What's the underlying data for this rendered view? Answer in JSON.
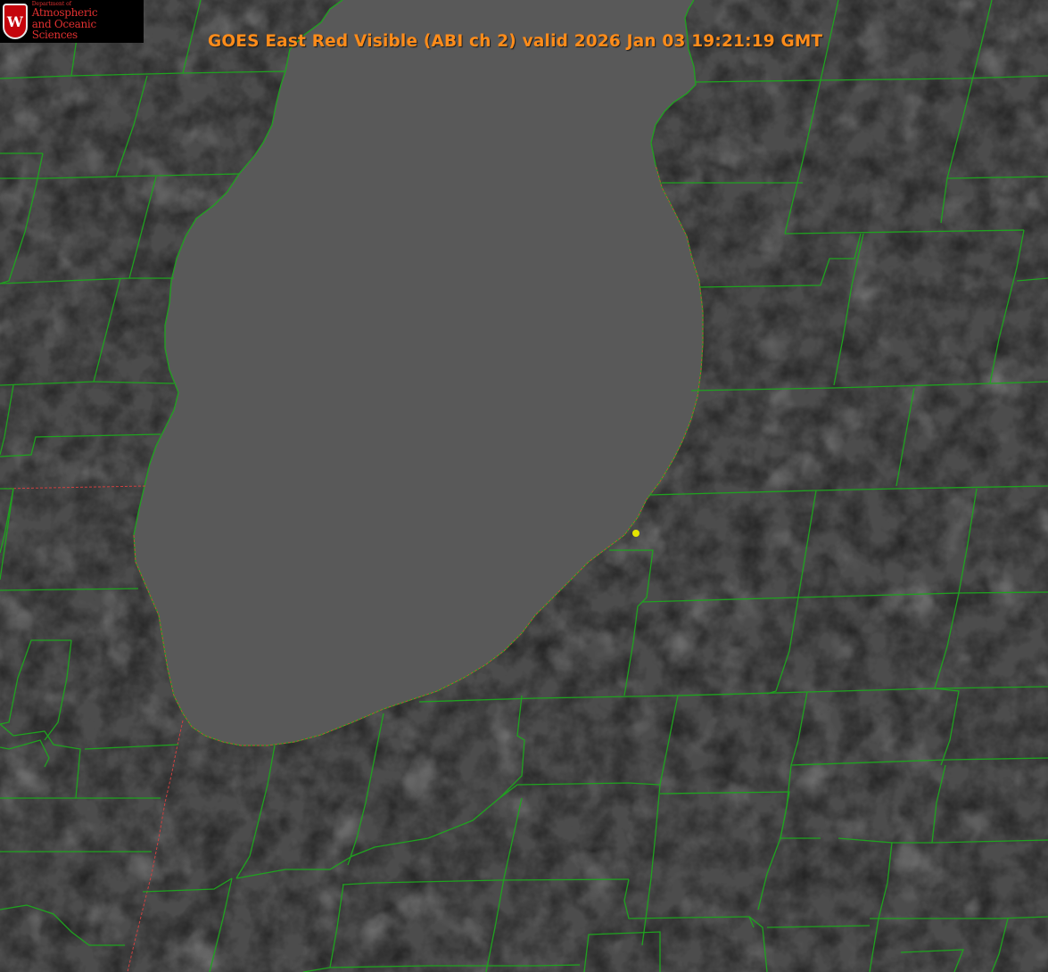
{
  "title": "GOES East Red Visible (ABI ch 2) valid 2026 Jan 03 19:21:19 GMT",
  "logo": {
    "seal_letter": "W",
    "dept": "Department of",
    "line1": "Atmospheric",
    "line2": "and Oceanic Sciences"
  },
  "colors": {
    "background": "#4a4a4a",
    "lake": "#565656",
    "county_lines": "#1fa31f",
    "state_border": "#d04040",
    "title": "#ff8c1a",
    "station_marker": "#e6e600"
  },
  "map": {
    "imagery": "visible satellite grayscale",
    "features": [
      "county-boundaries",
      "state-boundaries",
      "lake-michigan-shoreline",
      "station-marker"
    ]
  }
}
